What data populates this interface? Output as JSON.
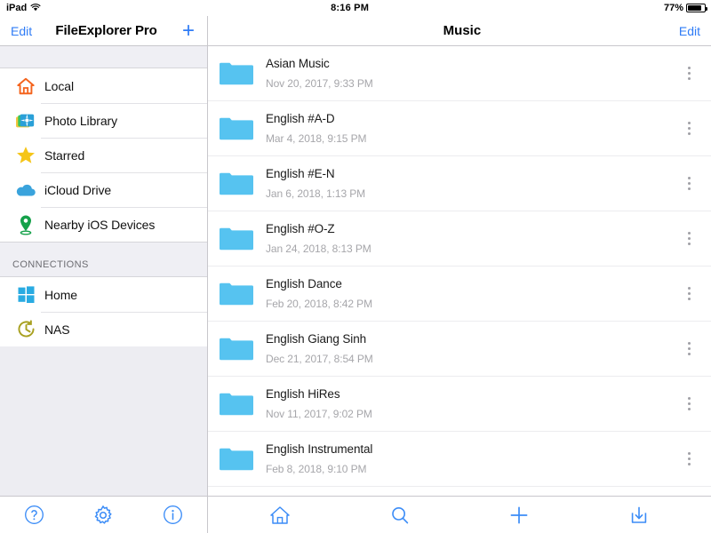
{
  "statusbar": {
    "device_label": "iPad",
    "wifi_icon": "wifi-icon",
    "time": "8:16 PM",
    "battery_percent": "77%",
    "battery_icon": "battery-icon"
  },
  "sidebar": {
    "nav": {
      "edit_label": "Edit",
      "title": "FileExplorer Pro",
      "add_label": "+",
      "add_icon": "plus-icon"
    },
    "places": [
      {
        "label": "Local",
        "icon": "home-house-icon",
        "color": "#f4641e"
      },
      {
        "label": "Photo Library",
        "icon": "photo-library-icon",
        "color": "#34c759"
      },
      {
        "label": "Starred",
        "icon": "star-icon",
        "color": "#f5c518"
      },
      {
        "label": "iCloud Drive",
        "icon": "cloud-icon",
        "color": "#3aa3dc"
      },
      {
        "label": "Nearby iOS Devices",
        "icon": "map-pin-icon",
        "color": "#15a14a"
      }
    ],
    "connections_header": "CONNECTIONS",
    "connections": [
      {
        "label": "Home",
        "icon": "windows-logo-icon",
        "color": "#29abe2"
      },
      {
        "label": "NAS",
        "icon": "clock-history-icon",
        "color": "#a8a020"
      }
    ],
    "toolbar": [
      {
        "label": "Help",
        "icon": "question-circle-icon"
      },
      {
        "label": "Settings",
        "icon": "gear-icon"
      },
      {
        "label": "Info",
        "icon": "info-circle-icon"
      }
    ]
  },
  "main": {
    "nav": {
      "title": "Music",
      "edit_label": "Edit"
    },
    "folder_color": "#56c3f0",
    "rows": [
      {
        "name": "Asian Music",
        "date": "Nov 20, 2017, 9:33 PM",
        "icon": "folder-icon",
        "more_icon": "more-vertical-icon"
      },
      {
        "name": "English #A-D",
        "date": "Mar 4, 2018, 9:15 PM",
        "icon": "folder-icon",
        "more_icon": "more-vertical-icon"
      },
      {
        "name": "English #E-N",
        "date": "Jan 6, 2018, 1:13 PM",
        "icon": "folder-icon",
        "more_icon": "more-vertical-icon"
      },
      {
        "name": "English #O-Z",
        "date": "Jan 24, 2018, 8:13 PM",
        "icon": "folder-icon",
        "more_icon": "more-vertical-icon"
      },
      {
        "name": "English Dance",
        "date": "Feb 20, 2018, 8:42 PM",
        "icon": "folder-icon",
        "more_icon": "more-vertical-icon"
      },
      {
        "name": "English Giang Sinh",
        "date": "Dec 21, 2017, 8:54 PM",
        "icon": "folder-icon",
        "more_icon": "more-vertical-icon"
      },
      {
        "name": "English HiRes",
        "date": "Nov 11, 2017, 9:02 PM",
        "icon": "folder-icon",
        "more_icon": "more-vertical-icon"
      },
      {
        "name": "English Instrumental",
        "date": "Feb 8, 2018, 9:10 PM",
        "icon": "folder-icon",
        "more_icon": "more-vertical-icon"
      }
    ],
    "toolbar": [
      {
        "label": "Home",
        "icon": "home-house-icon"
      },
      {
        "label": "Search",
        "icon": "search-icon"
      },
      {
        "label": "Add",
        "icon": "plus-icon"
      },
      {
        "label": "Download",
        "icon": "download-box-icon"
      }
    ]
  },
  "theme": {
    "accent": "#2f7cf6",
    "tint": "#3b8cf7",
    "folder": "#56c3f0",
    "sidebar_bg": "#ededf2"
  }
}
